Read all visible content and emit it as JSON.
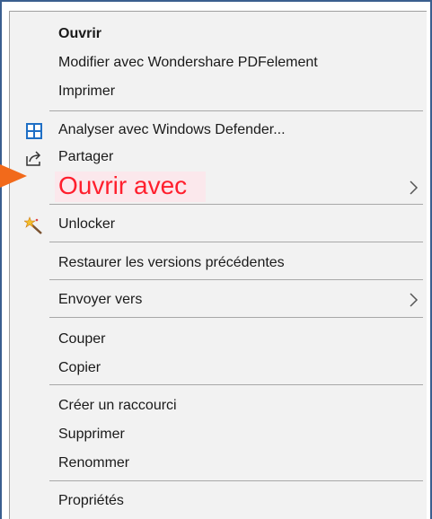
{
  "menu": {
    "items": [
      {
        "id": "open",
        "label": "Ouvrir"
      },
      {
        "id": "modify",
        "label": "Modifier avec Wondershare PDFelement"
      },
      {
        "id": "print",
        "label": "Imprimer"
      },
      {
        "id": "defender",
        "label": "Analyser avec Windows Defender..."
      },
      {
        "id": "share",
        "label": "Partager"
      },
      {
        "id": "open-with",
        "label": "Ouvrir avec"
      },
      {
        "id": "unlocker",
        "label": "Unlocker"
      },
      {
        "id": "restore",
        "label": "Restaurer les versions précédentes"
      },
      {
        "id": "send-to",
        "label": "Envoyer vers"
      },
      {
        "id": "cut",
        "label": "Couper"
      },
      {
        "id": "copy",
        "label": "Copier"
      },
      {
        "id": "shortcut",
        "label": "Créer un raccourci"
      },
      {
        "id": "delete",
        "label": "Supprimer"
      },
      {
        "id": "rename",
        "label": "Renommer"
      },
      {
        "id": "properties",
        "label": "Propriétés"
      }
    ]
  },
  "icons": {
    "defender": "shield-icon",
    "share": "share-icon",
    "unlocker": "magic-wand-icon",
    "submenu": "chevron-right-icon",
    "pointer": "arrow-right-icon"
  },
  "colors": {
    "highlight_text": "#ff1f2d",
    "highlight_bg": "#fbe8ec",
    "arrow": "#f26a1b",
    "defender_blue": "#1f6fc5"
  }
}
